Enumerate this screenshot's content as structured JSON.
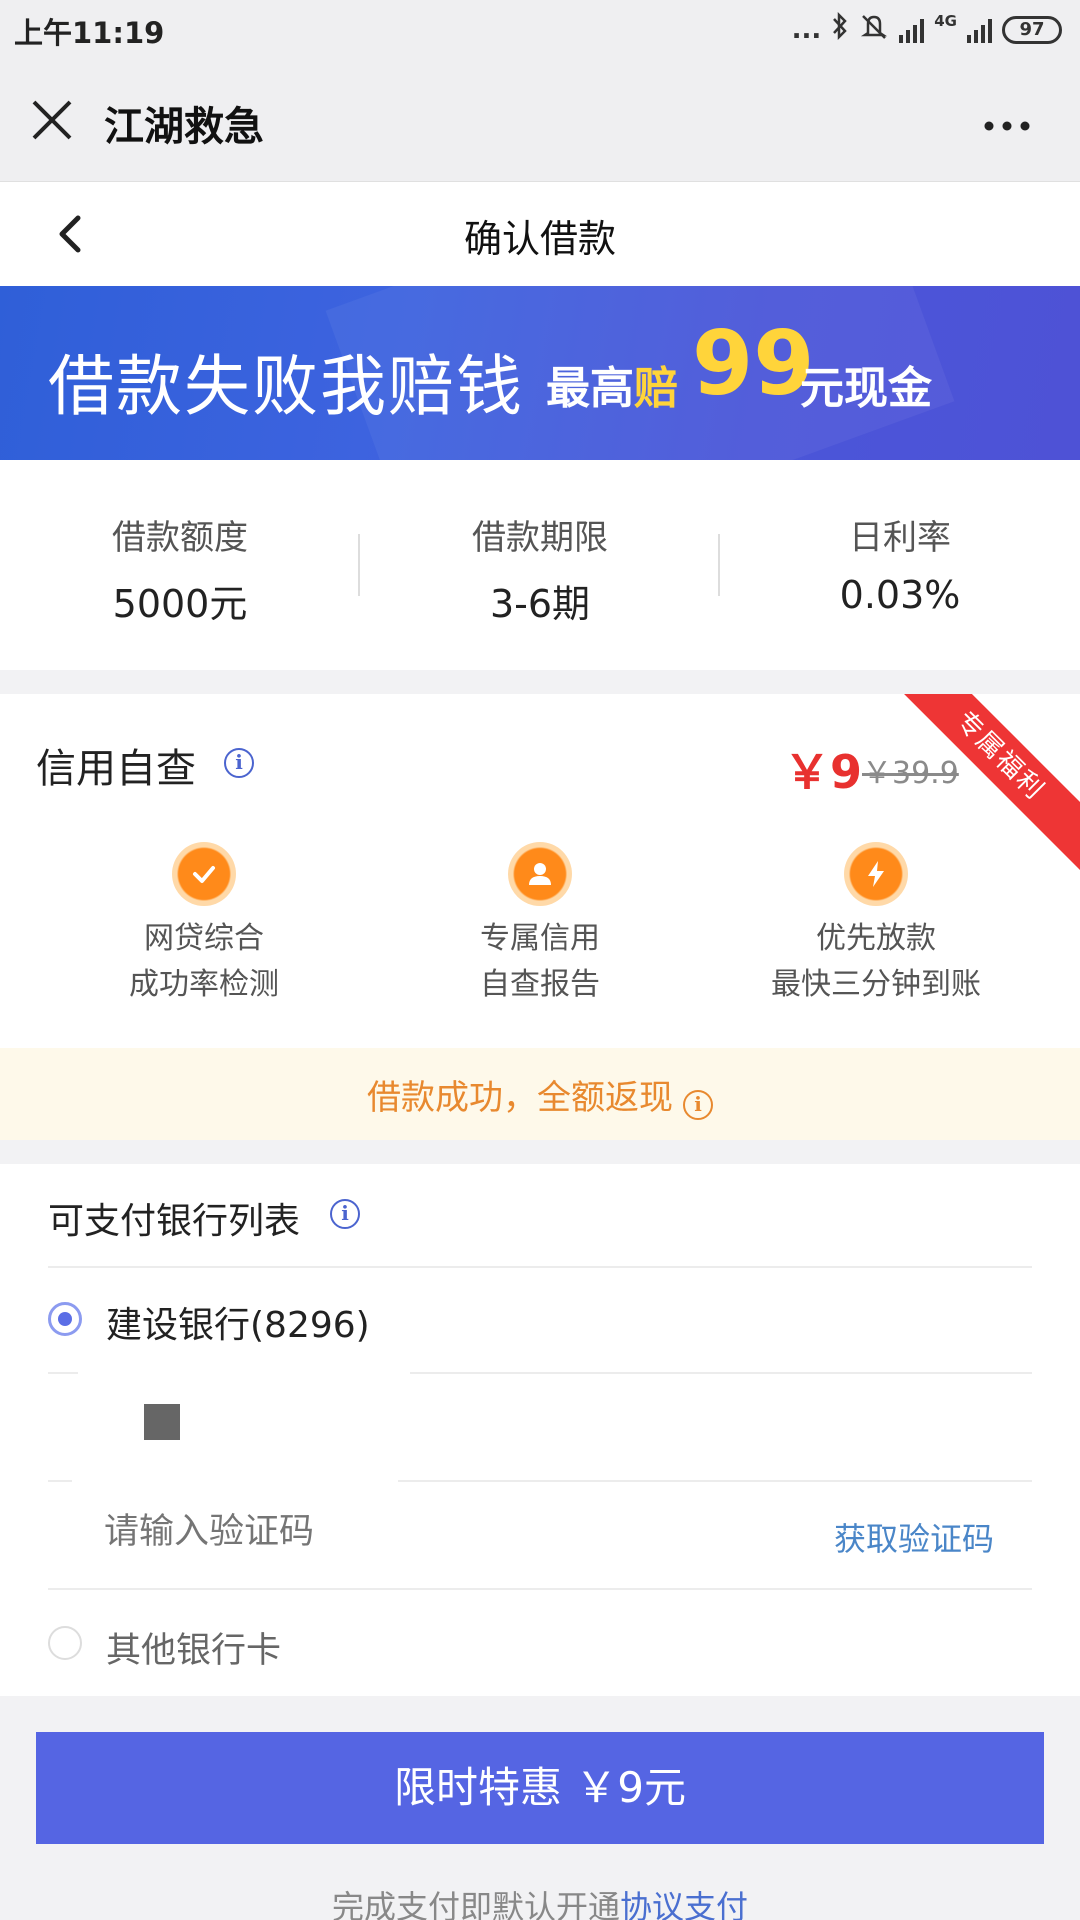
{
  "status_bar": {
    "time": "上午11:19",
    "dots": "...",
    "network": "4G",
    "battery": "97"
  },
  "topbar": {
    "title": "江湖救急",
    "close_icon": "close-icon",
    "more_icon": "more-icon"
  },
  "page_header": {
    "title": "确认借款",
    "back_icon": "chevron-left-icon"
  },
  "banner": {
    "main_text": "借款失败我赔钱",
    "prefix": "最高",
    "pei": "赔",
    "amount": "99",
    "suffix": "元现金"
  },
  "loan_info": [
    {
      "label": "借款额度",
      "value": "5000元"
    },
    {
      "label": "借款期限",
      "value": "3-6期"
    },
    {
      "label": "日利率",
      "value": "0.03%"
    }
  ],
  "credit_check": {
    "title": "信用自查",
    "price": "￥9",
    "original_price": "￥39.9",
    "ribbon": "专属福利",
    "features": [
      {
        "icon": "check-icon",
        "line1": "网贷综合",
        "line2": "成功率检测"
      },
      {
        "icon": "user-icon",
        "line1": "专属信用",
        "line2": "自查报告"
      },
      {
        "icon": "lightning-icon",
        "line1": "优先放款",
        "line2": "最快三分钟到账"
      }
    ],
    "cashback": "借款成功，全额返现"
  },
  "bank_list": {
    "title": "可支付银行列表",
    "selected_bank": "建设银行(8296)",
    "code_placeholder": "请输入验证码",
    "get_code": "获取验证码",
    "other_bank": "其他银行卡"
  },
  "pay_button": "限时特惠 ￥9元",
  "footnote": {
    "text": "完成支付即默认开通",
    "link": "协议支付"
  },
  "colors": {
    "accent": "#5565e3",
    "price_red": "#e8312f",
    "banner_yellow": "#ffd43a",
    "cashback_orange": "#e8892f",
    "link_blue": "#4a86c8"
  }
}
